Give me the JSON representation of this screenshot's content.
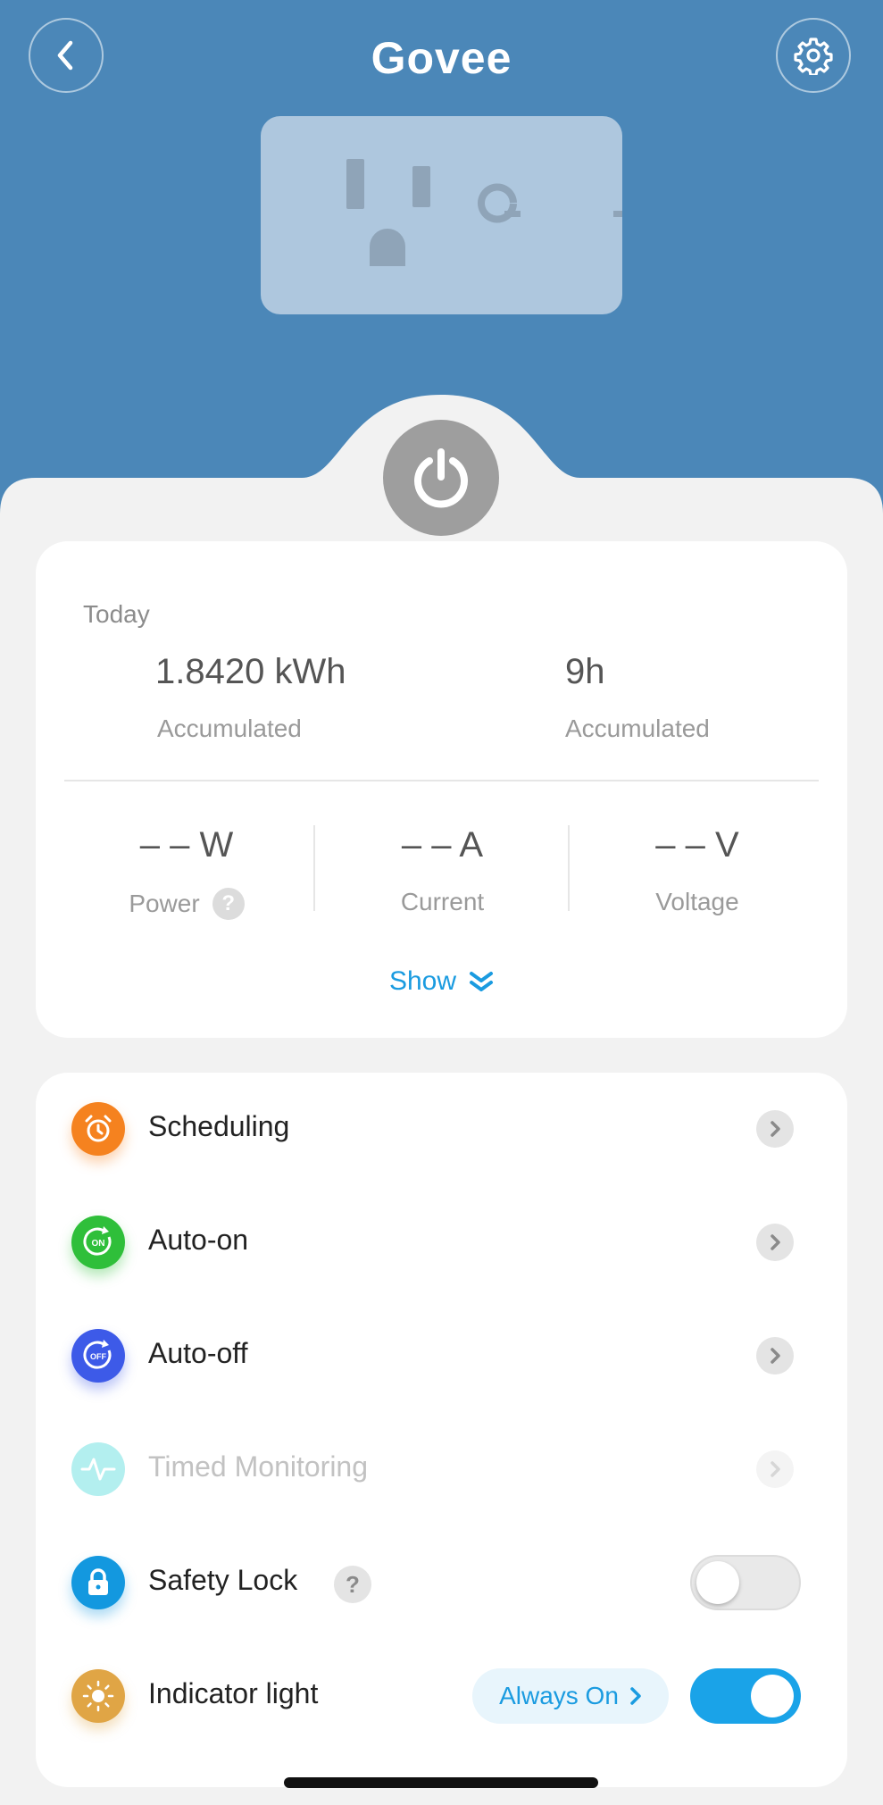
{
  "header": {
    "brand": "Govee",
    "back_icon": "chevron-left-icon",
    "settings_icon": "gear-icon"
  },
  "power_button": {
    "icon": "power-icon",
    "state": "off"
  },
  "stats": {
    "period_label": "Today",
    "energy": {
      "value": "1.8420 kWh",
      "label": "Accumulated"
    },
    "time": {
      "value": "9h",
      "label": "Accumulated"
    },
    "power": {
      "value": "– – W",
      "label": "Power"
    },
    "current": {
      "value": "– – A",
      "label": "Current"
    },
    "voltage": {
      "value": "– – V",
      "label": "Voltage"
    },
    "show_label": "Show"
  },
  "features": {
    "items": [
      {
        "label": "Scheduling",
        "icon": "alarm-clock-icon",
        "color": "#f5821f"
      },
      {
        "label": "Auto-on",
        "icon": "auto-on-icon",
        "color": "#2fbf3a"
      },
      {
        "label": "Auto-off",
        "icon": "auto-off-icon",
        "color": "#3d5ae8"
      },
      {
        "label": "Timed Monitoring",
        "icon": "pulse-icon",
        "color": "#8ee3e3",
        "disabled": true
      },
      {
        "label": "Safety Lock",
        "icon": "lock-icon",
        "color": "#1398df",
        "toggle": false
      },
      {
        "label": "Indicator light",
        "icon": "sun-icon",
        "color": "#e0a545",
        "toggle": true,
        "mode": "Always On"
      }
    ]
  },
  "colors": {
    "header_bg": "#4b87b8",
    "accent": "#1aa3e8",
    "power_button": "#9e9e9e"
  }
}
